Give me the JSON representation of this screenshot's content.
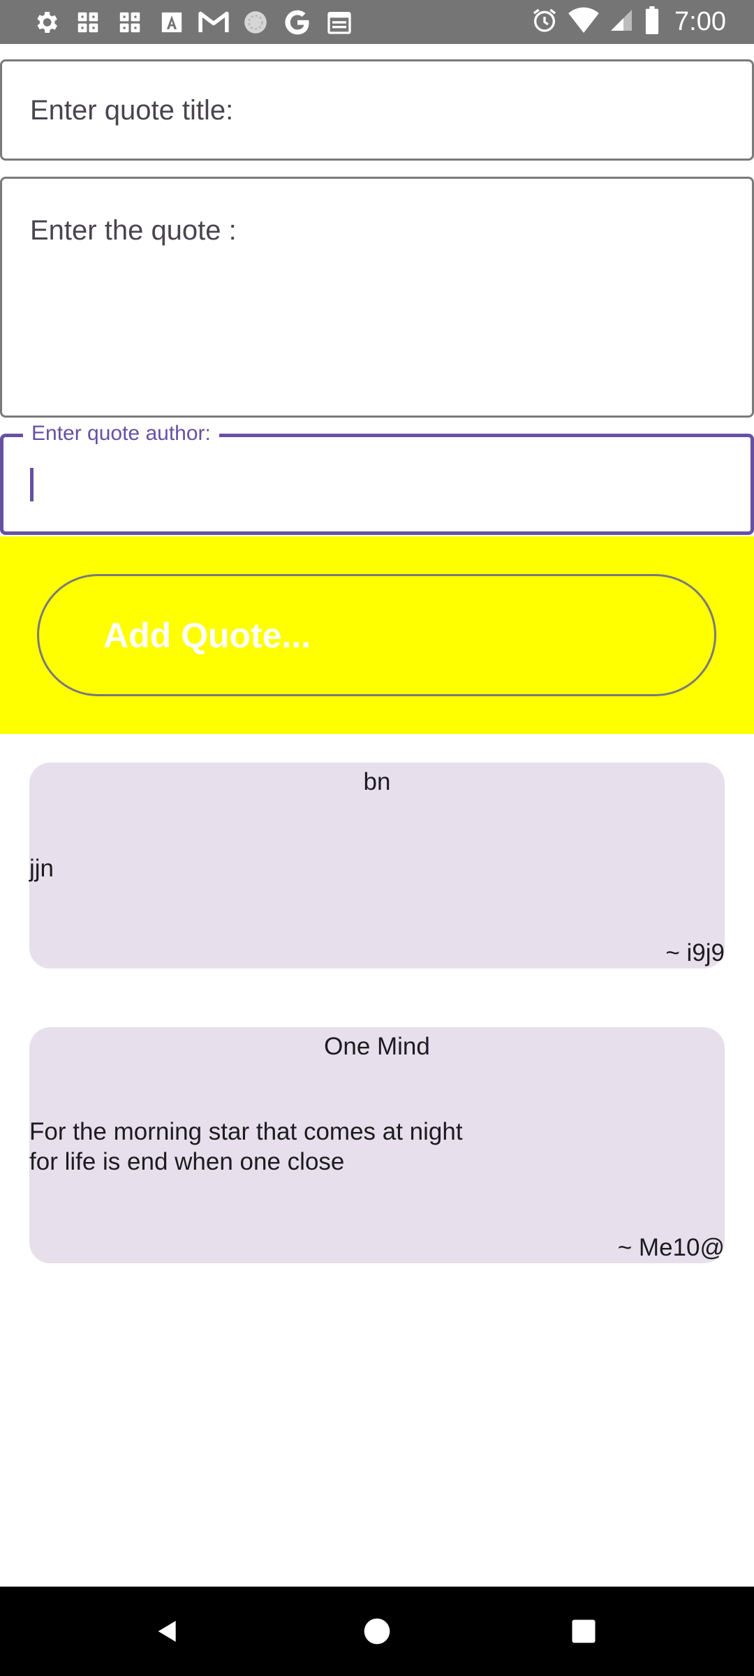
{
  "status_bar": {
    "time": "7:00",
    "left_icons": [
      "settings-icon",
      "sim-card-icon",
      "sim-card-icon",
      "font-a-icon",
      "gmail-icon",
      "loading-circle-icon",
      "google-icon",
      "calendar-icon"
    ],
    "right_icons": [
      "alarm-icon",
      "wifi-icon",
      "signal-icon",
      "battery-icon"
    ]
  },
  "form": {
    "title_placeholder": "Enter quote title:",
    "quote_placeholder": "Enter the quote :",
    "author_label": "Enter quote author:",
    "author_value": "",
    "add_button_label": "Add Quote..."
  },
  "quotes": [
    {
      "title": "bn",
      "text": "jjn",
      "author": "~ i9j9"
    },
    {
      "title": "One Mind",
      "text": "For the morning star that comes at night\nfor life is end when one close",
      "author": "~ Me10@"
    }
  ],
  "colors": {
    "status_bar": "#757575",
    "accent": "#6750a4",
    "button_area": "#ffff00",
    "card": "#e7e0ec",
    "nav_bar": "#000000"
  },
  "nav_bar": {
    "icons": [
      "back-icon",
      "home-icon",
      "recent-apps-icon"
    ]
  }
}
